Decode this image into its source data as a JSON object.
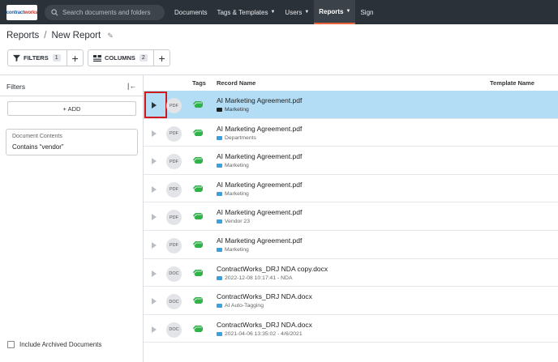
{
  "logo": {
    "part1": "contract",
    "part2": "works"
  },
  "search": {
    "placeholder": "Search documents and folders"
  },
  "nav": [
    {
      "label": "Documents",
      "chevron": false
    },
    {
      "label": "Tags & Templates",
      "chevron": true
    },
    {
      "label": "Users",
      "chevron": true
    },
    {
      "label": "Reports",
      "chevron": true,
      "active": true
    },
    {
      "label": "Sign",
      "chevron": false
    }
  ],
  "breadcrumb": {
    "parent": "Reports",
    "separator": "/",
    "current": "New Report"
  },
  "toolbar": {
    "filters_label": "FILTERS",
    "filters_count": "1",
    "columns_label": "COLUMNS",
    "columns_count": "2"
  },
  "filters_panel": {
    "title": "Filters",
    "add_label": "+ ADD",
    "filter_card": {
      "title": "Document Contents",
      "value": "Contains “vendor”"
    },
    "include_archived_label": "Include Archived Documents"
  },
  "table": {
    "headers": {
      "tags": "Tags",
      "record_name": "Record Name",
      "template_name": "Template Name"
    },
    "rows": [
      {
        "type": "PDF",
        "name": "AI Marketing Agreement.pdf",
        "folder": "Marketing",
        "selected": true
      },
      {
        "type": "PDF",
        "name": "AI Marketing Agreement.pdf",
        "folder": "Departments"
      },
      {
        "type": "PDF",
        "name": "AI Marketing Agreement.pdf",
        "folder": "Marketing"
      },
      {
        "type": "PDF",
        "name": "AI Marketing Agreement.pdf",
        "folder": "Marketing"
      },
      {
        "type": "PDF",
        "name": "AI Marketing Agreement.pdf",
        "folder": "Vendor 23"
      },
      {
        "type": "PDF",
        "name": "AI Marketing Agreement.pdf",
        "folder": "Marketing"
      },
      {
        "type": "DOC",
        "name": "ContractWorks_DRJ NDA copy.docx",
        "folder": "2022-12-08 10:17:41 - NDA"
      },
      {
        "type": "DOC",
        "name": "ContractWorks_DRJ NDA.docx",
        "folder": "AI Auto-Tagging"
      },
      {
        "type": "DOC",
        "name": "ContractWorks_DRJ NDA.docx",
        "folder": "2021-04-06 13:35:02 - 4/6/2021"
      }
    ]
  },
  "colors": {
    "topbar": "#2b3138",
    "accent": "#e8653c",
    "selected_row": "#b3dcf5",
    "tag_green": "#2fb34a",
    "folder_blue": "#3aa0de",
    "highlight_red": "#d0191f"
  }
}
